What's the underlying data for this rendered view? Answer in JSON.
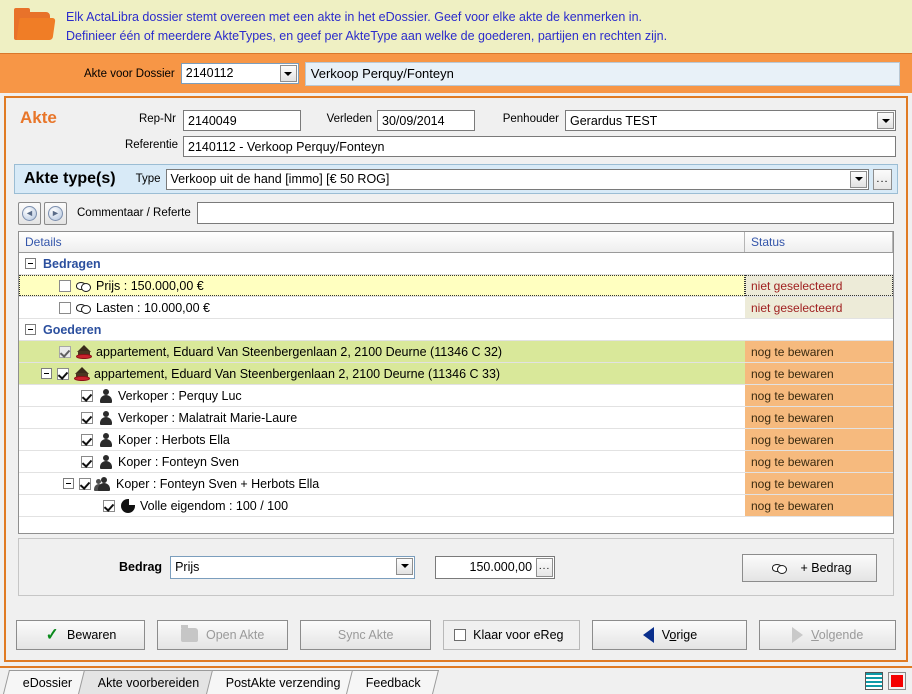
{
  "banner": {
    "line1": "Elk ActaLibra dossier stemt overeen met een akte in het eDossier. Geef voor elke akte de kenmerken in.",
    "line2": "Definieer één of meerdere AkteTypes, en geef per AkteType aan welke de goederen, partijen en rechten zijn.",
    "icon": "folder-icon",
    "bg": "#eff0c3",
    "text_color": "#2b2bcc"
  },
  "dossier_bar": {
    "label": "Akte voor Dossier",
    "dossier_number": "2140112",
    "dossier_name": "Verkoop Perquy/Fonteyn",
    "bg": "#f79646"
  },
  "akte": {
    "title": "Akte",
    "rep_nr_label": "Rep-Nr",
    "rep_nr_value": "2140049",
    "verleden_label": "Verleden",
    "verleden_value": "30/09/2014",
    "penhouder_label": "Penhouder",
    "penhouder_value": "Gerardus TEST",
    "referentie_label": "Referentie",
    "referentie_value": "2140112 - Verkoop Perquy/Fonteyn",
    "title_color": "#e8762a"
  },
  "akte_type": {
    "title": "Akte type(s)",
    "type_label": "Type",
    "type_value": "Verkoop uit de hand [immo] [€ 50 ROG]",
    "ellipsis_label": "...",
    "band_bg": "#d8eaf7"
  },
  "comment": {
    "prev_icon": "arrow-left-circle-icon",
    "next_icon": "arrow-right-circle-icon",
    "prev_glyph": "◄",
    "next_glyph": "►",
    "label": "Commentaar / Referte",
    "value": "",
    "placeholder": ""
  },
  "grid": {
    "columns": [
      "Details",
      "Status"
    ],
    "status_colors": {
      "niet_geselecteerd": "#a02020",
      "nog_te_bewaren": "#3a2a10"
    },
    "row_colors": {
      "yellow": "#ffffc0",
      "beige": "#edebd8",
      "green": "#d9e89a",
      "orange": "#f6ba7e"
    },
    "rows": [
      {
        "kind": "group",
        "indent": 0,
        "expander": "collapse",
        "label": "Bedragen",
        "status": "",
        "rowbg": "white",
        "statusbg": "white"
      },
      {
        "kind": "item",
        "indent": 1,
        "checkbox": "unchecked",
        "icon": "money-icon",
        "label": "Prijs : 150.000,00 €",
        "status": "niet geselecteerd",
        "rowbg": "yellow",
        "statusbg": "beige",
        "selected": true
      },
      {
        "kind": "item",
        "indent": 1,
        "checkbox": "unchecked",
        "icon": "money-icon",
        "label": "Lasten : 10.000,00 €",
        "status": "niet geselecteerd",
        "rowbg": "white",
        "statusbg": "beige"
      },
      {
        "kind": "group",
        "indent": 0,
        "expander": "collapse",
        "label": "Goederen",
        "status": "",
        "rowbg": "white",
        "statusbg": "white"
      },
      {
        "kind": "item",
        "indent": 1,
        "checkbox": "checked-disabled",
        "icon": "house-icon",
        "label": "appartement, Eduard Van Steenbergenlaan 2, 2100 Deurne (11346 C 32)",
        "status": "nog te bewaren",
        "rowbg": "green",
        "statusbg": "orange"
      },
      {
        "kind": "item",
        "indent": 1,
        "expander": "collapse",
        "checkbox": "checked",
        "icon": "house-icon",
        "label": "appartement, Eduard Van Steenbergenlaan 2, 2100 Deurne (11346 C 33)",
        "status": "nog te bewaren",
        "rowbg": "green",
        "statusbg": "orange"
      },
      {
        "kind": "item",
        "indent": 2,
        "checkbox": "checked",
        "icon": "person-icon",
        "label": "Verkoper : Perquy Luc",
        "status": "nog te bewaren",
        "rowbg": "white",
        "statusbg": "orange"
      },
      {
        "kind": "item",
        "indent": 2,
        "checkbox": "checked",
        "icon": "person-icon",
        "label": "Verkoper : Malatrait Marie-Laure",
        "status": "nog te bewaren",
        "rowbg": "white",
        "statusbg": "orange"
      },
      {
        "kind": "item",
        "indent": 2,
        "checkbox": "checked",
        "icon": "person-icon",
        "label": "Koper : Herbots Ella",
        "status": "nog te bewaren",
        "rowbg": "white",
        "statusbg": "orange"
      },
      {
        "kind": "item",
        "indent": 2,
        "checkbox": "checked",
        "icon": "person-icon",
        "label": "Koper : Fonteyn Sven",
        "status": "nog te bewaren",
        "rowbg": "white",
        "statusbg": "orange"
      },
      {
        "kind": "item",
        "indent": 2,
        "expander": "collapse",
        "checkbox": "checked",
        "icon": "people-icon",
        "label": "Koper : Fonteyn Sven + Herbots Ella",
        "status": "nog te bewaren",
        "rowbg": "white",
        "statusbg": "orange"
      },
      {
        "kind": "item",
        "indent": 3,
        "checkbox": "checked",
        "icon": "pie-icon",
        "label": "Volle eigendom : 100 / 100",
        "status": "nog te bewaren",
        "rowbg": "white",
        "statusbg": "orange"
      }
    ]
  },
  "bedrag": {
    "label": "Bedrag",
    "type_value": "Prijs",
    "amount_value": "150.000,00",
    "ellipsis_label": "...",
    "add_button_label": "+ Bedrag",
    "add_button_icon": "money-icon"
  },
  "actions": {
    "save_label": "Bewaren",
    "save_icon": "check-icon",
    "open_akte_label": "Open Akte",
    "open_akte_icon": "folder-icon",
    "sync_akte_label": "Sync Akte",
    "ereg_label": "Klaar voor eReg",
    "ereg_checked": false,
    "vorige_label": "Vorige",
    "vorige_icon": "triangle-left-icon",
    "volgende_label": "Volgende",
    "volgende_icon": "triangle-right-icon"
  },
  "tabs": [
    {
      "label": "eDossier",
      "active": false
    },
    {
      "label": "Akte voorbereiden",
      "active": true
    },
    {
      "label": "PostAkte verzending",
      "active": false
    },
    {
      "label": "Feedback",
      "active": false
    }
  ],
  "tray": {
    "icon1": "striped-indicator-icon",
    "icon2": "red-square-icon"
  }
}
